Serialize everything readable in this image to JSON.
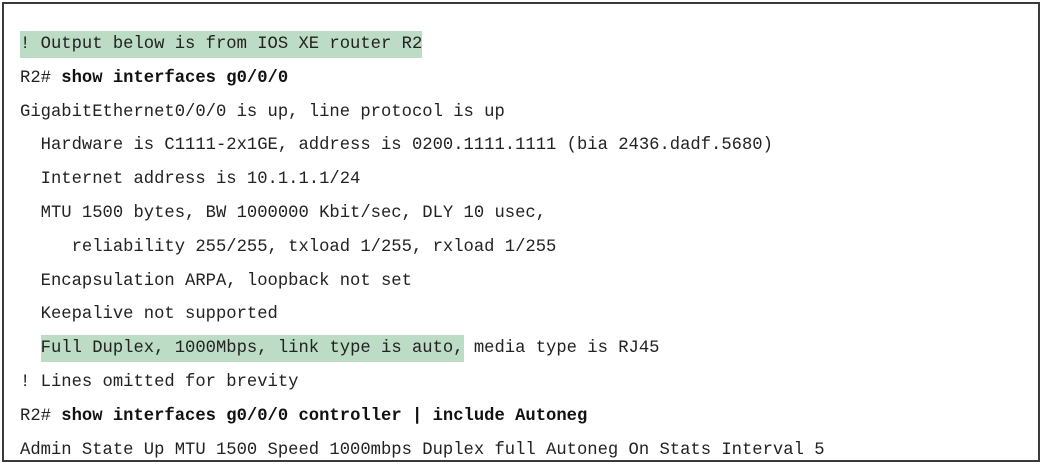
{
  "highlight_color": "#bcdcc6",
  "lines": {
    "l1": {
      "text": "! Output below is from IOS XE router R2"
    },
    "l2": {
      "prompt": "R2# ",
      "command": "show interfaces g0/0/0"
    },
    "l3": {
      "text": "GigabitEthernet0/0/0 is up, line protocol is up"
    },
    "l4": {
      "text": "  Hardware is C1111-2x1GE, address is 0200.1111.1111 (bia 2436.dadf.5680)"
    },
    "l5": {
      "text": "  Internet address is 10.1.1.1/24"
    },
    "l6": {
      "text": "  MTU 1500 bytes, BW 1000000 Kbit/sec, DLY 10 usec,"
    },
    "l7": {
      "text": "     reliability 255/255, txload 1/255, rxload 1/255"
    },
    "l8": {
      "text": "  Encapsulation ARPA, loopback not set"
    },
    "l9": {
      "text": "  Keepalive not supported"
    },
    "l10": {
      "indent": "  ",
      "highlighted": "Full Duplex, 1000Mbps, link type is auto,",
      "rest": " media type is RJ45"
    },
    "l11": {
      "text": "! Lines omitted for brevity"
    },
    "l12": {
      "prompt": "R2# ",
      "command": "show interfaces g0/0/0 controller | include Autoneg"
    },
    "l13": {
      "text": "Admin State Up MTU 1500 Speed 1000mbps Duplex full Autoneg On Stats Interval 5"
    }
  }
}
